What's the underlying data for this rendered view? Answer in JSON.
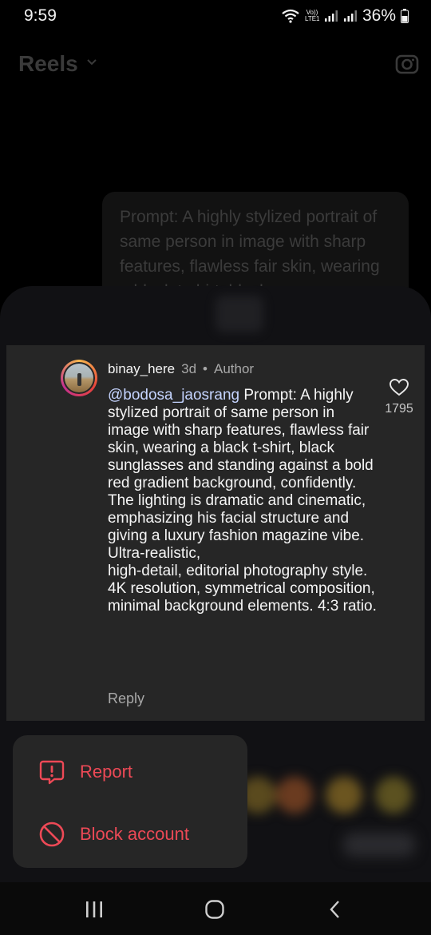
{
  "status_bar": {
    "time": "9:59",
    "volte_label": "Vo)) LTE1",
    "battery": "36%",
    "icons": [
      "wifi-icon",
      "signal-icon",
      "signal-icon",
      "battery-icon"
    ]
  },
  "background": {
    "reels_title": "Reels",
    "prompt_preview": "Prompt: A highly stylized portrait of same person in image with sharp features, flawless fair skin, wearing a black t-shirt, black"
  },
  "comment": {
    "username": "binay_here",
    "age": "3d",
    "separator": "•",
    "author_label": "Author",
    "mention": "@bodosa_jaosrang",
    "text": " Prompt: A highly stylized portrait of same person in image with sharp features, flawless fair skin, wearing a black t-shirt, black sunglasses and standing against a bold red gradient background, confidently.\nThe lighting is dramatic and cinematic, emphasizing his facial structure and giving a luxury fashion magazine vibe.\nUltra-realistic,\nhigh-detail, editorial photography style.\n4K resolution, symmetrical composition, minimal background elements. 4:3 ratio.",
    "reply_label": "Reply",
    "like_count": "1795"
  },
  "menu": {
    "report_label": "Report",
    "block_label": "Block account"
  },
  "colors": {
    "danger": "#ed4956",
    "mention": "#c5d4ff",
    "card_bg": "#262626"
  }
}
